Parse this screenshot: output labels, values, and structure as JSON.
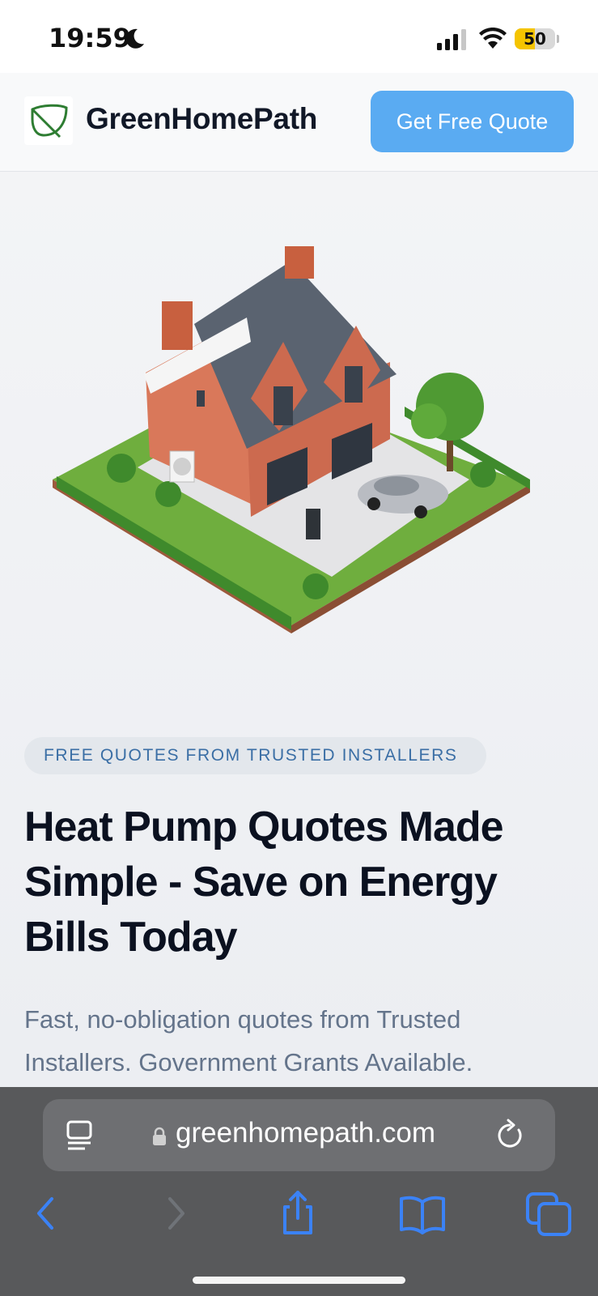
{
  "status_bar": {
    "time": "19:59",
    "battery_level": 50,
    "battery_text": "50",
    "icons": [
      "moon-icon",
      "cellular-signal-icon",
      "wifi-icon",
      "battery-icon"
    ]
  },
  "header": {
    "brand": "GreenHomePath",
    "logo_icon": "leaf-icon",
    "cta_label": "Get Free Quote",
    "cta_color": "#5aabf2"
  },
  "hero": {
    "illustration": "isometric-house-with-heat-pump-illustration",
    "badge": "FREE QUOTES FROM TRUSTED INSTALLERS",
    "title": "Heat Pump Quotes Made Simple - Save on Energy Bills Today",
    "subtitle": "Fast, no-obligation quotes from Trusted Installers. Government Grants Available."
  },
  "browser": {
    "url": "greenhomepath.com",
    "toolbar": [
      "back-icon",
      "forward-icon",
      "share-icon",
      "bookmarks-icon",
      "tabs-icon"
    ],
    "accent_color": "#3b82f6"
  }
}
